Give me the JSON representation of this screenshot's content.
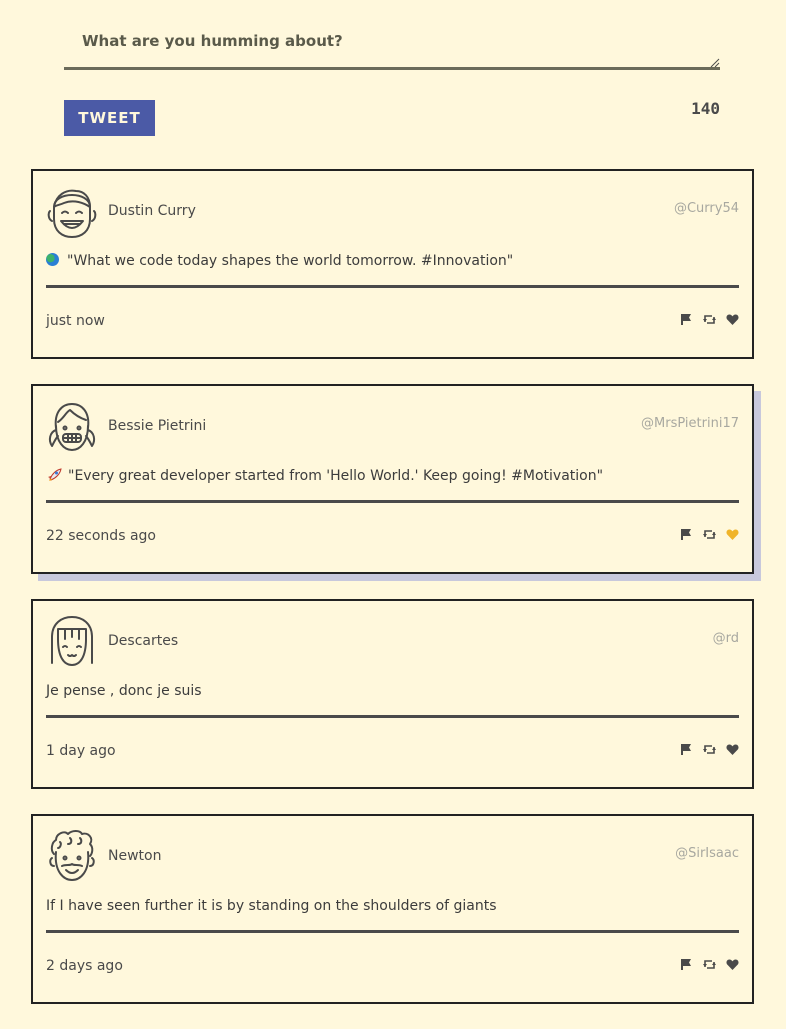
{
  "composer": {
    "placeholder": "What are you humming about?",
    "button_label": "Tweet",
    "char_count": "140"
  },
  "colors": {
    "background": "#fff8dc",
    "button": "#4b5aa6",
    "heart_liked": "#f0b429",
    "hover_shadow": "#c8c8dc"
  },
  "tweets": [
    {
      "author": "Dustin Curry",
      "handle": "@Curry54",
      "emoji": "earth-emoji",
      "content": "\"What we code today shapes the world tomorrow. #Innovation\"",
      "time": "just now",
      "liked": false,
      "avatar": "smiling-man-avatar-icon"
    },
    {
      "author": "Bessie Pietrini",
      "handle": "@MrsPietrini17",
      "emoji": "rocket-emoji",
      "content": "\"Every great developer started from 'Hello World.' Keep going! #Motivation\"",
      "time": "22 seconds ago",
      "liked": true,
      "avatar": "girl-pigtails-avatar-icon"
    },
    {
      "author": "Descartes",
      "handle": "@rd",
      "content": "Je pense , donc je suis",
      "time": "1 day ago",
      "liked": false,
      "avatar": "bob-hair-avatar-icon"
    },
    {
      "author": "Newton",
      "handle": "@SirIsaac",
      "content": "If I have seen further it is by standing on the shoulders of giants",
      "time": "2 days ago",
      "liked": false,
      "avatar": "curly-hair-avatar-icon"
    }
  ]
}
